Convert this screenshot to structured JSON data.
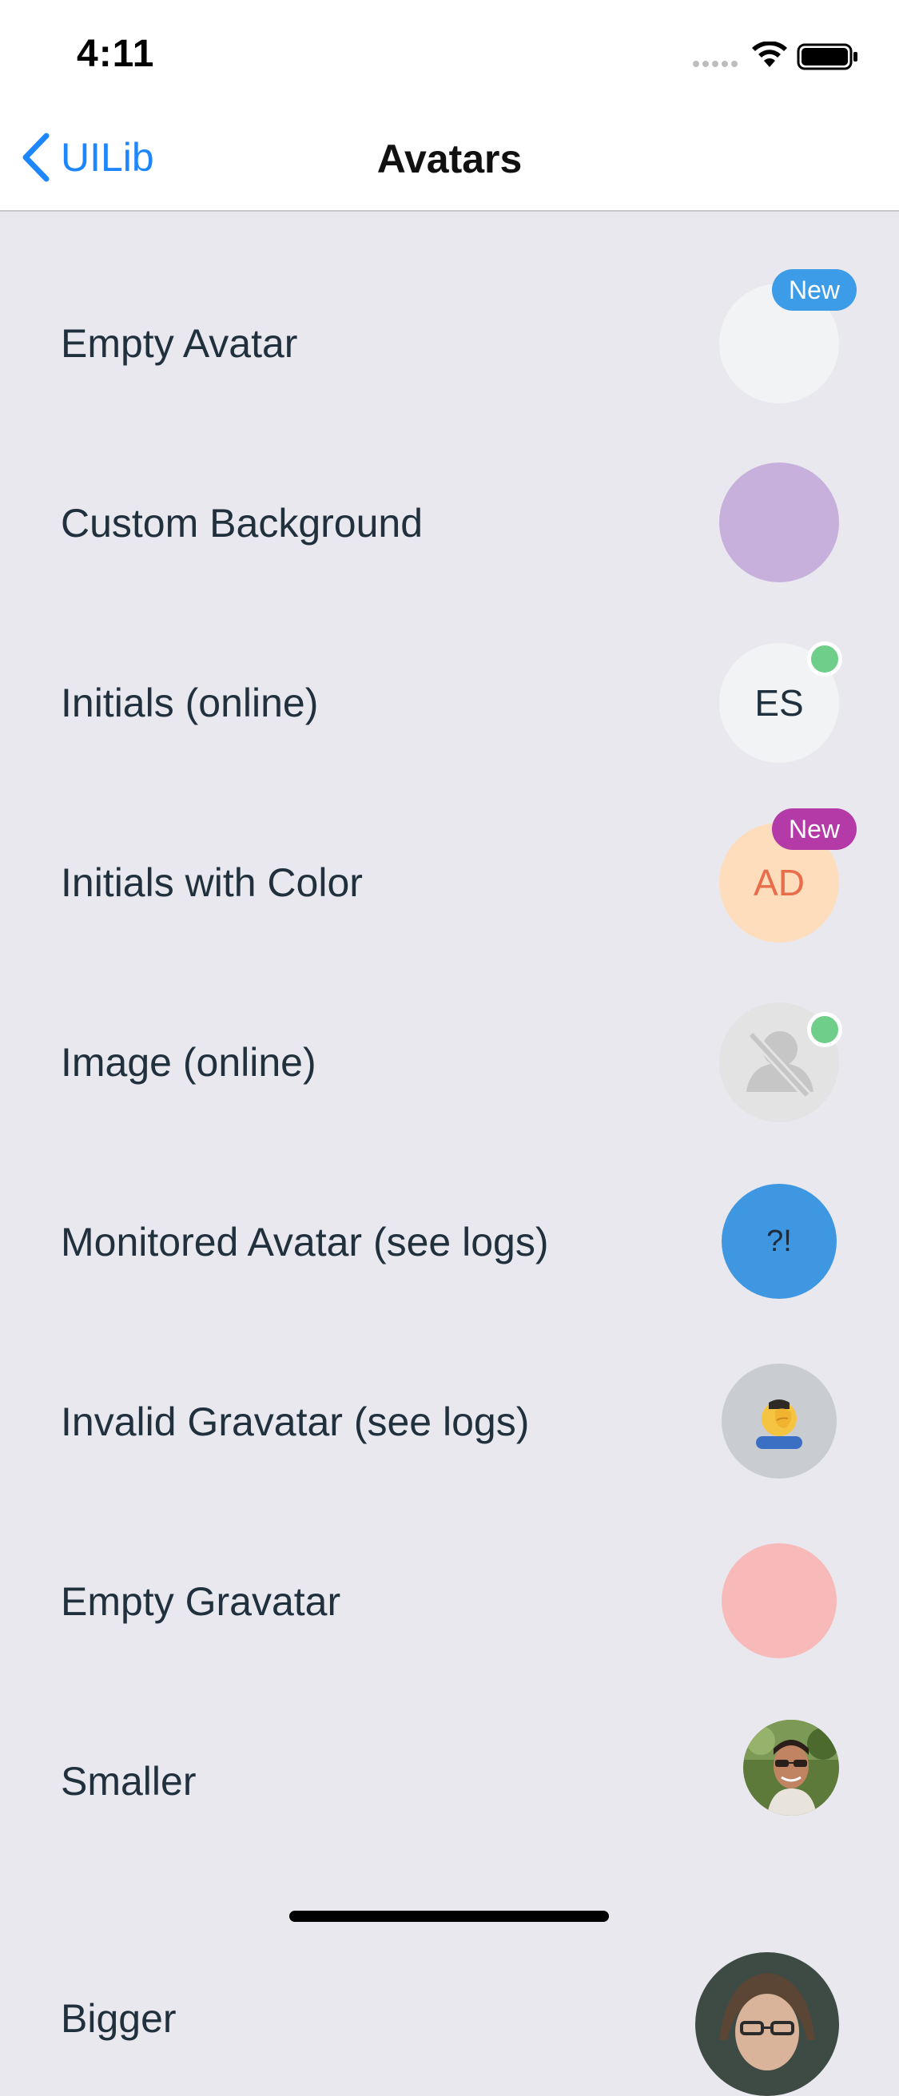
{
  "status_bar": {
    "time": "4:11",
    "icons": [
      "cellular-signal-icon",
      "wifi-icon",
      "battery-icon"
    ]
  },
  "nav": {
    "back_label": "UILib",
    "title": "Avatars",
    "accent_color": "#1E86FF"
  },
  "rows": [
    {
      "label": "Empty Avatar",
      "badge": "New",
      "badge_color": "#3D9CE8"
    },
    {
      "label": "Custom Background",
      "color": "#C7B0DB"
    },
    {
      "label": "Initials (online)",
      "initials": "ES",
      "status": "online"
    },
    {
      "label": "Initials with Color",
      "initials": "AD",
      "badge": "New",
      "badge_color": "#B43AA8",
      "color": "#FEDDBC",
      "text_color": "#E76D4B"
    },
    {
      "label": "Image (online)",
      "status": "online",
      "icon": "no-avatar-icon"
    },
    {
      "label": "Monitored Avatar (see logs)",
      "initials": "?!",
      "color": "#3F97E2"
    },
    {
      "label": "Invalid Gravatar (see logs)",
      "icon": "facepalm-emoji-icon",
      "color": "#C9CCD0"
    },
    {
      "label": "Empty Gravatar",
      "color": "#F8BAB8"
    },
    {
      "label": "Smaller",
      "icon": "user-photo"
    },
    {
      "label": "Bigger",
      "icon": "user-photo"
    }
  ],
  "colors": {
    "background": "#E9E8EF",
    "online": "#6FCF8A",
    "empty_avatar": "#F2F3F5"
  }
}
